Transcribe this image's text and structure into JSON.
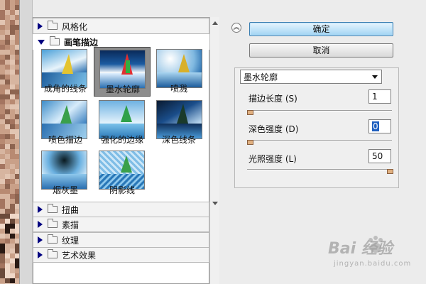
{
  "filter_tree": {
    "categories_top": [
      {
        "label": "风格化",
        "expanded": false
      }
    ],
    "expanded_category": {
      "label": "画笔描边",
      "expanded": true
    },
    "thumbnails": [
      {
        "label": "成角的线条",
        "selected": false
      },
      {
        "label": "墨水轮廓",
        "selected": true
      },
      {
        "label": "喷溅",
        "selected": false
      },
      {
        "label": "喷色描边",
        "selected": false
      },
      {
        "label": "强化的边缘",
        "selected": false
      },
      {
        "label": "深色线条",
        "selected": false
      },
      {
        "label": "烟灰墨",
        "selected": false
      },
      {
        "label": "阴影线",
        "selected": false
      }
    ],
    "categories_bottom": [
      {
        "label": "扭曲"
      },
      {
        "label": "素描"
      },
      {
        "label": "纹理"
      },
      {
        "label": "艺术效果"
      }
    ]
  },
  "actions": {
    "ok_label": "确定",
    "cancel_label": "取消"
  },
  "settings": {
    "filter_select_value": "墨水轮廓",
    "params": [
      {
        "label": "描边长度 (S)",
        "value": "1",
        "slider_fraction": 0.0
      },
      {
        "label": "深色强度 (D)",
        "value": "0",
        "slider_fraction": 0.0
      },
      {
        "label": "光照强度 (L)",
        "value": "50",
        "slider_fraction": 1.0
      }
    ]
  },
  "watermark": {
    "text": "Bai 经验",
    "sub": "jingyan.baidu.com"
  },
  "colors": {
    "ok_button": "#9fd3f4",
    "selected_thumb_bg": "#8d8d8d",
    "tree_arrow": "#000080",
    "focused_value": "#1f5fbf"
  }
}
